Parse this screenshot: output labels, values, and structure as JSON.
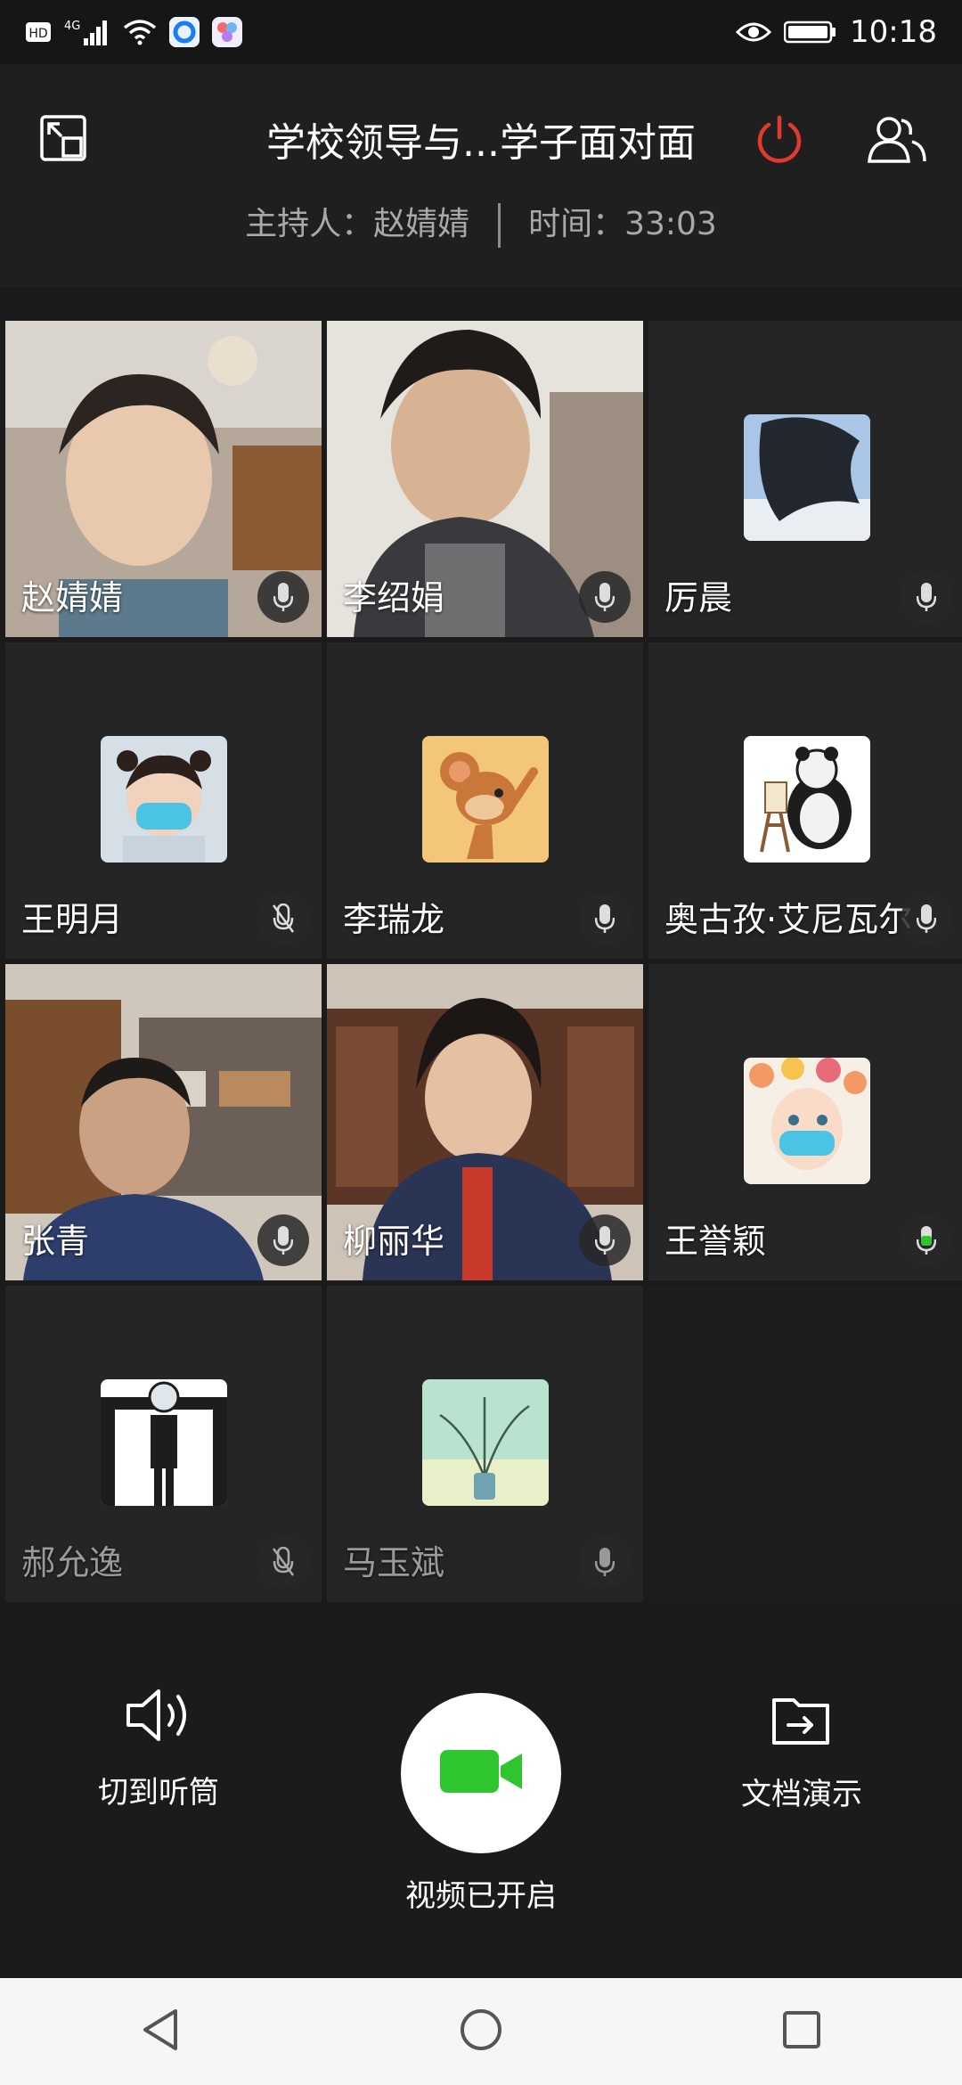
{
  "status_bar": {
    "left_icons": [
      "hd-icon",
      "signal-4g-icon",
      "wifi-icon",
      "app-icon-blue",
      "app-icon-multicolor"
    ],
    "network_label": "4G",
    "time": "10:18",
    "right_icons": [
      "eye-icon",
      "battery-icon"
    ]
  },
  "header": {
    "title": "学校领导与...学子面对面",
    "host_label": "主持人：赵婧婧",
    "time_label": "时间：33:03",
    "exit_color": "#e03a2f"
  },
  "participants": [
    {
      "name": "赵婧婧",
      "video": true,
      "mic": "on"
    },
    {
      "name": "李绍娟",
      "video": true,
      "mic": "on"
    },
    {
      "name": "厉晨",
      "video": false,
      "mic": "on",
      "avatar": "hair-photo"
    },
    {
      "name": "王明月",
      "video": false,
      "mic": "muted",
      "avatar": "girl-mask"
    },
    {
      "name": "李瑞龙",
      "video": false,
      "mic": "on",
      "avatar": "cartoon-mouse"
    },
    {
      "name": "奥古孜·艾尼瓦尔",
      "video": false,
      "mic": "on",
      "avatar": "panda-painter"
    },
    {
      "name": "张青",
      "video": true,
      "mic": "on"
    },
    {
      "name": "柳丽华",
      "video": true,
      "mic": "on"
    },
    {
      "name": "王誉颖",
      "video": false,
      "mic": "speaking",
      "avatar": "flower-girl-mask"
    },
    {
      "name": "郝允逸",
      "video": false,
      "mic": "muted",
      "avatar": "mask-figure",
      "dim": true
    },
    {
      "name": "马玉斌",
      "video": false,
      "mic": "on",
      "avatar": "plant-vase",
      "dim": true
    }
  ],
  "controls": {
    "speaker_label": "切到听筒",
    "video_label": "视频已开启",
    "doc_label": "文档演示",
    "video_color": "#2ec52f"
  }
}
